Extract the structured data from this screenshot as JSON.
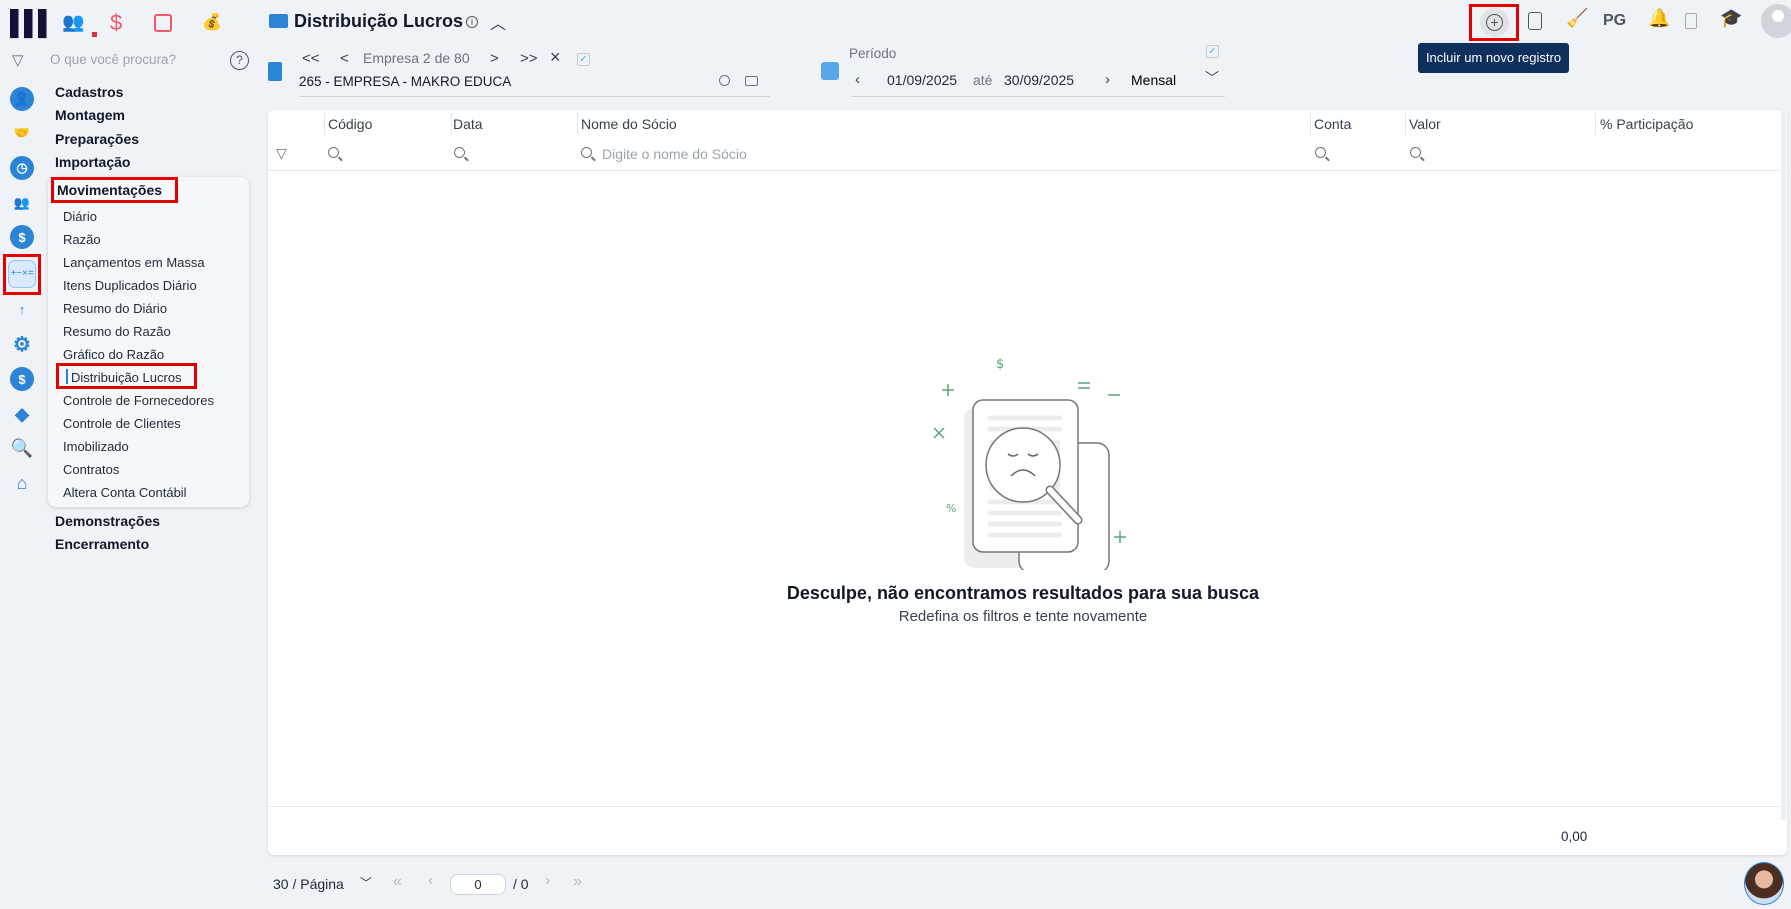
{
  "header": {
    "title": "Distribuição Lucros",
    "info_icon": "info-icon"
  },
  "company": {
    "pager": "Empresa 2 de 80",
    "name": "265 - EMPRESA - MAKRO EDUCA",
    "first": "<<",
    "prev": "<",
    "next": ">",
    "last": ">>",
    "clear": "×"
  },
  "period": {
    "label": "Período",
    "start": "01/09/2025",
    "sep": "até",
    "end": "30/09/2025",
    "mode": "Mensal"
  },
  "search": {
    "placeholder": "O que você procura?"
  },
  "toolbar": {
    "pg": "PG",
    "tooltip": "Incluir um novo registro"
  },
  "menu": {
    "sections": [
      "Cadastros",
      "Montagem",
      "Preparações",
      "Importação"
    ],
    "active_section": "Movimentações",
    "items": [
      "Diário",
      "Razão",
      "Lançamentos em Massa",
      "Itens Duplicados Diário",
      "Resumo do Diário",
      "Resumo do Razão",
      "Gráfico do Razão",
      "Distribuição Lucros",
      "Controle de Fornecedores",
      "Controle de Clientes",
      "Imobilizado",
      "Contratos",
      "Altera Conta Contábil"
    ],
    "after": [
      "Demonstrações",
      "Encerramento"
    ]
  },
  "table": {
    "columns": [
      "Código",
      "Data",
      "Nome do Sócio",
      "Conta",
      "Valor",
      "% Participação"
    ],
    "name_filter_placeholder": "Digite o nome do Sócio",
    "total": "0,00"
  },
  "empty": {
    "title": "Desculpe, não encontramos resultados para sua busca",
    "subtitle": "Redefina os filtros e tente novamente"
  },
  "pagination": {
    "per_page": "30 / Página",
    "page": "0",
    "total": "/ 0",
    "first": "«",
    "prev": "‹",
    "next": "›",
    "last": "»"
  },
  "colors": {
    "accent": "#2b84d6",
    "highlight": "#e50000",
    "tooltip": "#0f2f5c",
    "illustration": "#5aa37a"
  }
}
